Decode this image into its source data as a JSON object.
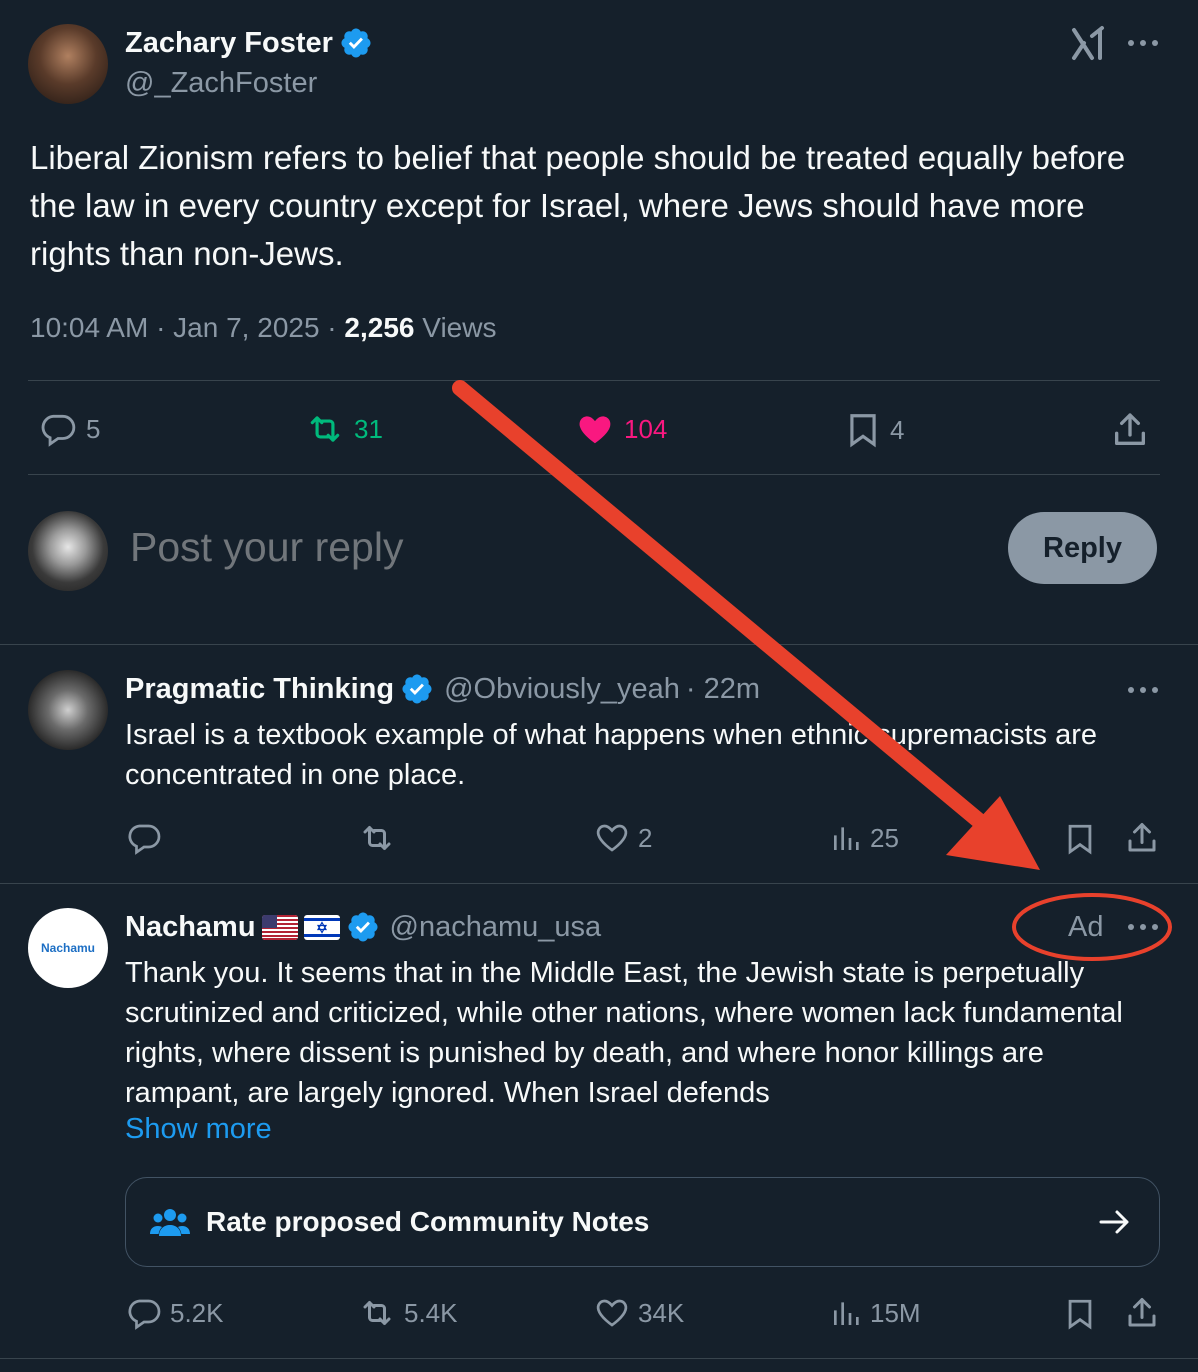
{
  "main_post": {
    "author_name": "Zachary Foster",
    "author_handle": "@_ZachFoster",
    "body": "Liberal Zionism refers to belief that people should be treated equally before the law in every country except for Israel, where Jews should have more rights than non-Jews.",
    "time": "10:04 AM · Jan 7, 2025 · ",
    "views_count": "2,256",
    "views_label": " Views",
    "replies": "5",
    "reposts": "31",
    "likes": "104",
    "bookmarks": "4"
  },
  "composer": {
    "placeholder": "Post your reply",
    "reply_button": "Reply"
  },
  "reply_1": {
    "author_name": "Pragmatic Thinking",
    "author_handle": "@Obviously_yeah",
    "time": " · 22m",
    "body": "Israel is a textbook example of what happens when ethnic supremacists are concentrated in one place.",
    "likes": "2",
    "views": "25"
  },
  "ad_post": {
    "author_name": "Nachamu",
    "author_handle": "@nachamu_usa",
    "avatar_text": "Nachamu",
    "ad_label": "Ad",
    "body": "Thank you. It seems that in the Middle East, the Jewish state is perpetually scrutinized and criticized, while other nations, where women lack fundamental rights, where dissent is punished by death, and where honor killings are rampant, are largely ignored. When Israel defends",
    "show_more": "Show more",
    "community_notes": "Rate proposed Community Notes",
    "replies": "5.2K",
    "reposts": "5.4K",
    "likes": "34K",
    "views": "15M"
  },
  "colors": {
    "background": "#15202b",
    "accent": "#1d9bf0",
    "annotation": "#e8412c",
    "like": "#f91880",
    "repost": "#00ba7c"
  }
}
